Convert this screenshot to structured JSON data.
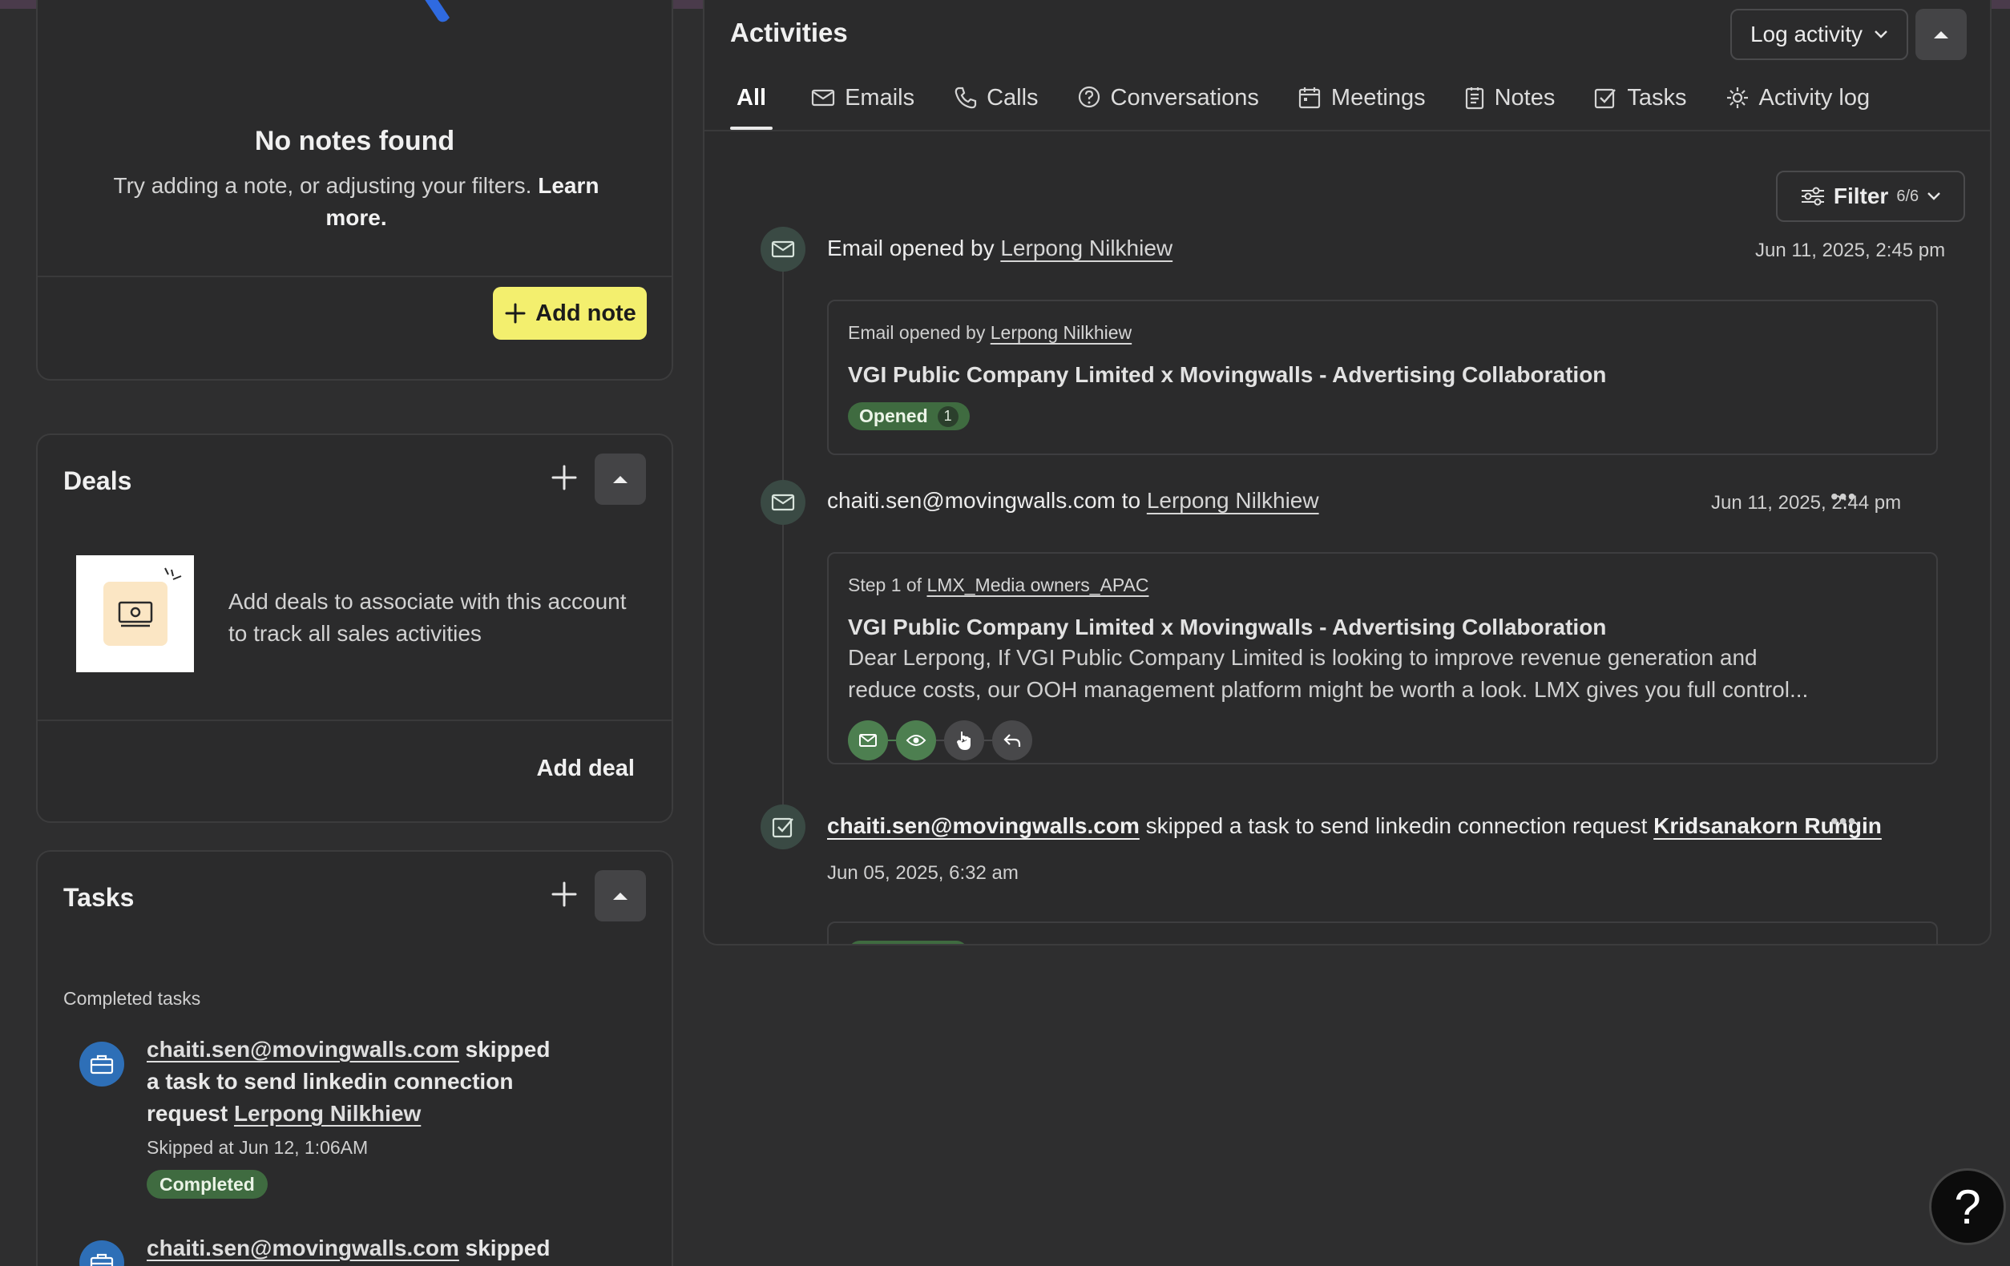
{
  "notes": {
    "empty_title": "No notes found",
    "empty_text": "Try adding a note, or adjusting your filters. ",
    "learn_more": "Learn more.",
    "add_note_label": "Add note"
  },
  "deals": {
    "title": "Deals",
    "empty_text": "Add deals to associate with this account to track all sales activities",
    "add_deal_label": "Add deal"
  },
  "tasks": {
    "title": "Tasks",
    "completed_label": "Completed tasks",
    "items": [
      {
        "actor": "chaiti.sen@movingwalls.com",
        "action_1": " skipped",
        "action_2": "a task to send linkedin connection",
        "action_3": "request ",
        "target": "Lerpong Nilkhiew",
        "meta": "Skipped at Jun 12, 1:06AM",
        "status": "Completed"
      },
      {
        "actor": "chaiti.sen@movingwalls.com",
        "action_1": " skipped"
      }
    ]
  },
  "activities": {
    "title": "Activities",
    "log_activity_label": "Log activity",
    "tabs": [
      {
        "label": "All",
        "icon": "none"
      },
      {
        "label": "Emails",
        "icon": "mail-icon"
      },
      {
        "label": "Calls",
        "icon": "phone-icon"
      },
      {
        "label": "Conversations",
        "icon": "chat-question-icon"
      },
      {
        "label": "Meetings",
        "icon": "calendar-icon"
      },
      {
        "label": "Notes",
        "icon": "note-icon"
      },
      {
        "label": "Tasks",
        "icon": "task-check-icon"
      },
      {
        "label": "Activity log",
        "icon": "gear-icon"
      }
    ],
    "filter": {
      "label": "Filter",
      "count": "6/6"
    },
    "events": [
      {
        "head_prefix": "Email opened by ",
        "head_person": "Lerpong Nilkhiew",
        "time": "Jun 11, 2025, 2:45 pm",
        "card_prefix": "Email opened by ",
        "card_person": "Lerpong Nilkhiew",
        "subject": "VGI Public Company Limited x Movingwalls - Advertising Collaboration",
        "badge": "Opened",
        "badge_count": "1"
      },
      {
        "head_from": "chaiti.sen@movingwalls.com",
        "head_to_word": " to ",
        "head_person": "Lerpong Nilkhiew",
        "time": "Jun 11, 2025, 2:44 pm",
        "step_prefix": "Step 1 of ",
        "sequence": "LMX_Media owners_APAC",
        "subject": "VGI Public Company Limited x Movingwalls - Advertising Collaboration",
        "preview_line1": "Dear Lerpong, If VGI Public Company Limited is looking to improve revenue generation and",
        "preview_line2": "reduce costs, our OOH management platform might be worth a look. LMX gives you full control..."
      },
      {
        "actor": "chaiti.sen@movingwalls.com",
        "action": " skipped a task to send linkedin connection request ",
        "target": "Kridsanakorn Rungin",
        "time": "Jun 05, 2025, 6:32 am"
      }
    ]
  },
  "help": {
    "label": "?"
  },
  "colors": {
    "accent_yellow": "#f3ef6e",
    "status_green": "#3f6b40",
    "avatar_blue": "#2e6fb7",
    "background": "#2e2e2f"
  }
}
